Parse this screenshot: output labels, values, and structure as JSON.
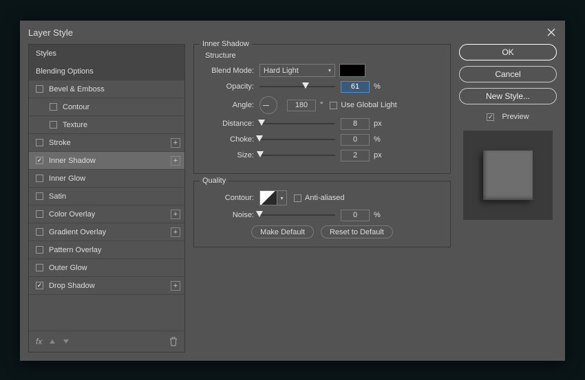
{
  "dialog": {
    "title": "Layer Style"
  },
  "buttons": {
    "ok": "OK",
    "cancel": "Cancel",
    "new_style": "New Style...",
    "preview": "Preview",
    "make_default": "Make Default",
    "reset_default": "Reset to Default"
  },
  "left": {
    "styles": "Styles",
    "blending": "Blending Options",
    "items": [
      {
        "label": "Bevel & Emboss",
        "checked": false,
        "plus": false,
        "indent": false
      },
      {
        "label": "Contour",
        "checked": false,
        "plus": false,
        "indent": true
      },
      {
        "label": "Texture",
        "checked": false,
        "plus": false,
        "indent": true
      },
      {
        "label": "Stroke",
        "checked": false,
        "plus": true,
        "indent": false
      },
      {
        "label": "Inner Shadow",
        "checked": true,
        "plus": true,
        "indent": false,
        "selected": true
      },
      {
        "label": "Inner Glow",
        "checked": false,
        "plus": false,
        "indent": false
      },
      {
        "label": "Satin",
        "checked": false,
        "plus": false,
        "indent": false
      },
      {
        "label": "Color Overlay",
        "checked": false,
        "plus": true,
        "indent": false
      },
      {
        "label": "Gradient Overlay",
        "checked": false,
        "plus": true,
        "indent": false
      },
      {
        "label": "Pattern Overlay",
        "checked": false,
        "plus": false,
        "indent": false
      },
      {
        "label": "Outer Glow",
        "checked": false,
        "plus": false,
        "indent": false
      },
      {
        "label": "Drop Shadow",
        "checked": true,
        "plus": true,
        "indent": false
      }
    ]
  },
  "panel": {
    "title": "Inner Shadow",
    "structure_title": "Structure",
    "quality_title": "Quality",
    "blend_mode_label": "Blend Mode:",
    "blend_mode_value": "Hard Light",
    "opacity_label": "Opacity:",
    "opacity_value": "61",
    "opacity_unit": "%",
    "angle_label": "Angle:",
    "angle_value": "180",
    "angle_unit": "°",
    "use_global_label": "Use Global Light",
    "distance_label": "Distance:",
    "distance_value": "8",
    "distance_unit": "px",
    "choke_label": "Choke:",
    "choke_value": "0",
    "choke_unit": "%",
    "size_label": "Size:",
    "size_value": "2",
    "size_unit": "px",
    "contour_label": "Contour:",
    "antialiased_label": "Anti-aliased",
    "noise_label": "Noise:",
    "noise_value": "0",
    "noise_unit": "%"
  },
  "slider_pos": {
    "opacity": "61%",
    "distance": "3%",
    "choke": "0%",
    "size": "1%",
    "noise": "0%"
  }
}
